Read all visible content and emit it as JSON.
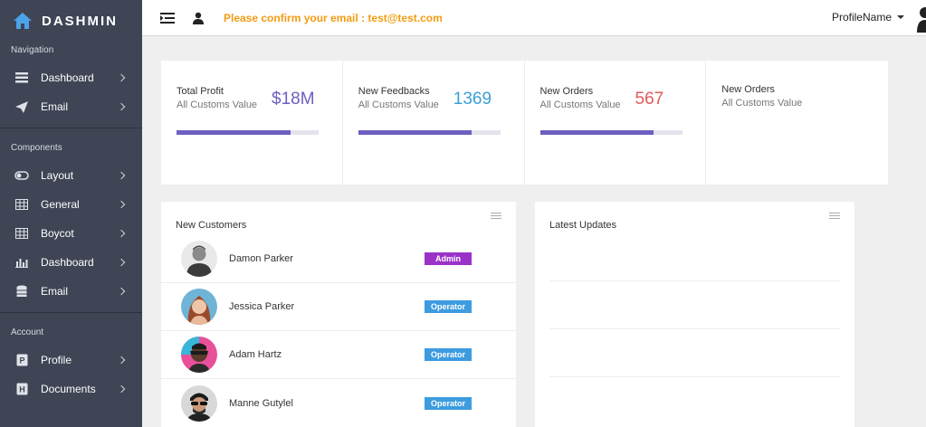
{
  "brand": {
    "name": "DASHMIN"
  },
  "sidebar": {
    "sections": [
      {
        "heading": "Navigation",
        "items": [
          {
            "label": "Dashboard",
            "icon": "list-icon"
          },
          {
            "label": "Email",
            "icon": "paper-plane-icon"
          }
        ]
      },
      {
        "heading": "Components",
        "items": [
          {
            "label": "Layout",
            "icon": "toggle-icon"
          },
          {
            "label": "General",
            "icon": "table-icon"
          },
          {
            "label": "Boycot",
            "icon": "table-icon"
          },
          {
            "label": "Dashboard",
            "icon": "bar-chart-icon"
          },
          {
            "label": "Email",
            "icon": "database-icon"
          }
        ]
      },
      {
        "heading": "Account",
        "items": [
          {
            "label": "Profile",
            "icon": "profile-icon"
          },
          {
            "label": "Documents",
            "icon": "documents-icon"
          }
        ]
      }
    ]
  },
  "topbar": {
    "confirm_text": "Please confirm your email : test@test.com",
    "profile_name": "ProfileName"
  },
  "stats": [
    {
      "title": "Total Profit",
      "subtitle": "All Customs Value",
      "value": "$18M",
      "color": "#6b5fbf",
      "progress": 0.8
    },
    {
      "title": "New Feedbacks",
      "subtitle": "All Customs Value",
      "value": "1369",
      "color": "#3aa0d8",
      "progress": 0.8
    },
    {
      "title": "New Orders",
      "subtitle": "All Customs Value",
      "value": "567",
      "color": "#e05a5a",
      "progress": 0.8
    },
    {
      "title": "New Orders",
      "subtitle": "All Customs Value",
      "value": "",
      "color": "#333333",
      "progress": null
    }
  ],
  "customers": {
    "title": "New Customers",
    "rows": [
      {
        "name": "Damon Parker",
        "role": "Admin",
        "badge_color": "#9b32c8"
      },
      {
        "name": "Jessica Parker",
        "role": "Operator",
        "badge_color": "#3d9be0"
      },
      {
        "name": "Adam Hartz",
        "role": "Operator",
        "badge_color": "#3d9be0"
      },
      {
        "name": "Manne Gutylel",
        "role": "Operator",
        "badge_color": "#3d9be0"
      }
    ]
  },
  "updates": {
    "title": "Latest Updates"
  }
}
